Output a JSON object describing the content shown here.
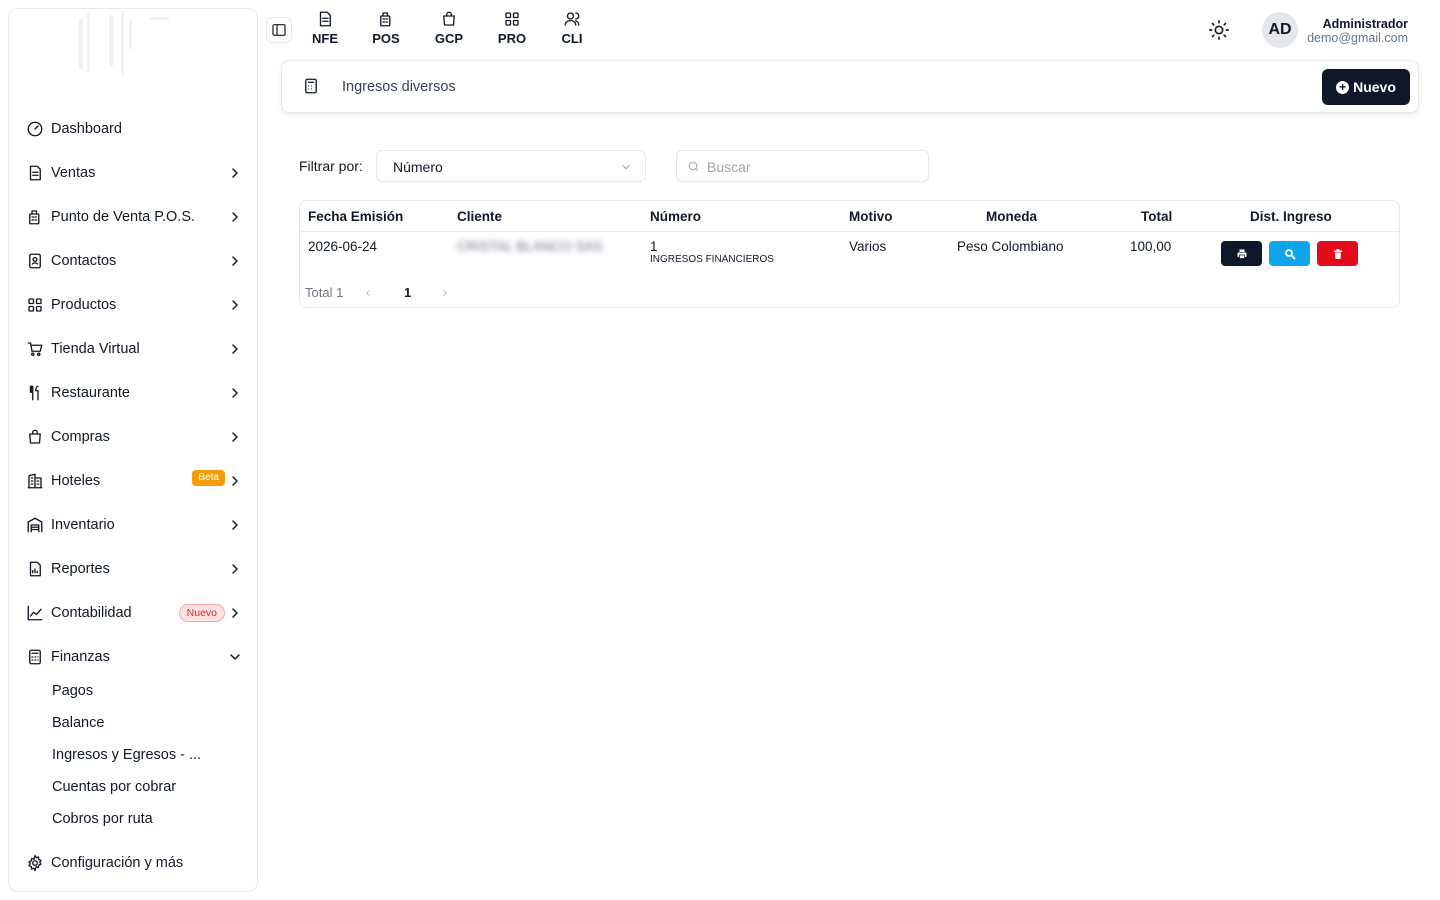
{
  "sidebar": {
    "items": [
      {
        "label": "Dashboard",
        "icon": "dashboard-icon"
      },
      {
        "label": "Ventas",
        "icon": "document-icon"
      },
      {
        "label": "Punto de Venta P.O.S.",
        "icon": "pos-icon"
      },
      {
        "label": "Contactos",
        "icon": "contacts-icon"
      },
      {
        "label": "Productos",
        "icon": "grid-icon"
      },
      {
        "label": "Tienda Virtual",
        "icon": "cart-icon"
      },
      {
        "label": "Restaurante",
        "icon": "utensils-icon"
      },
      {
        "label": "Compras",
        "icon": "bag-icon"
      },
      {
        "label": "Hoteles",
        "icon": "hotel-icon",
        "badge": "Beta"
      },
      {
        "label": "Inventario",
        "icon": "warehouse-icon"
      },
      {
        "label": "Reportes",
        "icon": "report-icon"
      },
      {
        "label": "Contabilidad",
        "icon": "chart-icon",
        "badge": "Nuevo"
      },
      {
        "label": "Finanzas",
        "icon": "calculator-icon"
      }
    ],
    "finanzas_sub": [
      "Pagos",
      "Balance",
      "Ingresos y Egresos - ...",
      "Cuentas por cobrar",
      "Cobros por ruta"
    ],
    "config_label": "Configuración y más"
  },
  "topbar": {
    "modules": [
      "NFE",
      "POS",
      "GCP",
      "PRO",
      "CLI"
    ],
    "avatar": "AD",
    "user_name": "Administrador",
    "user_email": "demo@gmail.com"
  },
  "header": {
    "title": "Ingresos diversos",
    "new_button": "Nuevo"
  },
  "filters": {
    "label": "Filtrar por:",
    "selected": "Número",
    "search_placeholder": "Buscar"
  },
  "table": {
    "columns": [
      "Fecha Emisión",
      "Cliente",
      "Número",
      "Motivo",
      "Moneda",
      "Total",
      "Dist. Ingreso"
    ],
    "rows": [
      {
        "fecha": "2026-06-24",
        "cliente": "CRISTAL BLANCO SAS",
        "numero": "1",
        "numero_sub": "INGRESOS FINANCIEROS",
        "motivo": "Varios",
        "moneda": "Peso Colombiano",
        "total": "100,00"
      }
    ]
  },
  "pagination": {
    "total_label": "Total 1",
    "current_page": "1"
  },
  "colors": {
    "primary": "#0f172a",
    "info": "#0ea5e9",
    "danger": "#e30b17",
    "beta": "#f59e0b"
  }
}
